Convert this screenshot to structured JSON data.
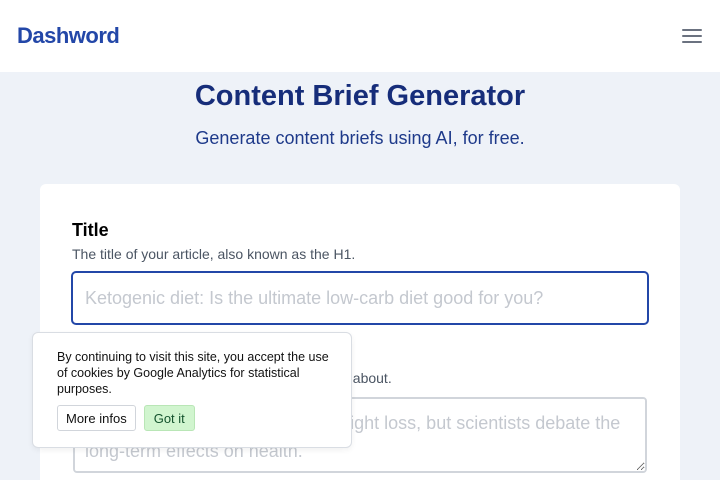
{
  "header": {
    "logo": "Dashword",
    "menu_icon": "hamburger-menu-icon"
  },
  "hero": {
    "title": "Content Brief Generator",
    "subtitle": "Generate content briefs using AI, for free."
  },
  "form": {
    "title_field": {
      "label": "Title",
      "help": "The title of your article, also known as the H1.",
      "value": "",
      "placeholder": "Ketogenic diet: Is the ultimate low-carb diet good for you?"
    },
    "description_field": {
      "help_visible": "ticle is about.",
      "value": "",
      "placeholder": "The ketogenic diet is linked to weight loss, but scientists debate the long-term effects on health."
    }
  },
  "cookie_banner": {
    "text": "By continuing to visit this site, you accept the use of cookies by Google Analytics for statistical purposes.",
    "more_label": "More infos",
    "ok_label": "Got it"
  },
  "colors": {
    "brand": "#2347a8",
    "heading": "#162d7a",
    "page_bg": "#eef2f8",
    "accept_bg": "#d1f5cf"
  }
}
